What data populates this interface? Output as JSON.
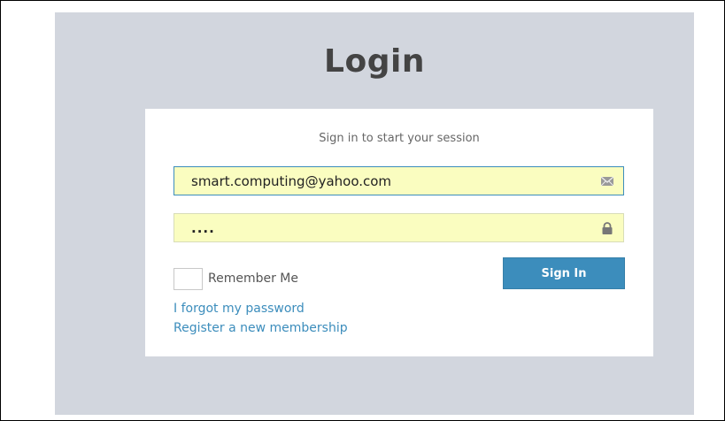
{
  "page": {
    "title": "Login",
    "subtitle": "Sign in to start your session"
  },
  "form": {
    "email_value": "smart.computing@yahoo.com",
    "email_icon": "envelope-icon",
    "password_value": "....",
    "password_icon": "lock-icon",
    "remember_label": "Remember Me",
    "remember_checked": false,
    "submit_label": "Sign In"
  },
  "links": {
    "forgot": "I forgot my password",
    "register": "Register a new membership"
  },
  "colors": {
    "background": "#d2d6de",
    "accent": "#3c8dbc",
    "autofill": "#fafdc0"
  }
}
